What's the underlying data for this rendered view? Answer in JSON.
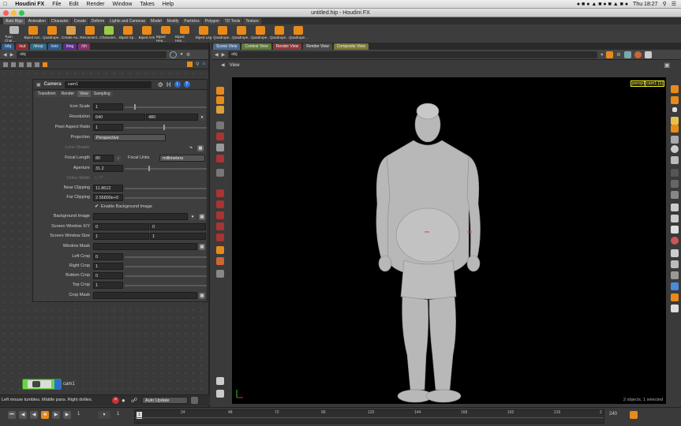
{
  "menubar": {
    "apple": "",
    "app_name": "Houdini FX",
    "items": [
      "File",
      "Edit",
      "Render",
      "Window",
      "Takes",
      "Help"
    ],
    "clock": "Thu 18:27"
  },
  "window": {
    "title": "untitled.hip - Houdini FX"
  },
  "shelf_tabs": [
    "Auto Rigs",
    "Animation",
    "Character",
    "Create",
    "Deform",
    "Lights and Cameras",
    "Model",
    "Modify",
    "Particles",
    "Polygon",
    "TD Tools",
    "Texture"
  ],
  "shelf_tools": [
    "Toon Char...",
    "Biped Aut...",
    "Quadrupe...",
    "Create Au...",
    "Reconnect...",
    "Character...",
    "Biped Sp...",
    "Biped Arm",
    "Biped Hea...",
    "Biped Han...",
    "Biped Leg",
    "Quadrupe...",
    "Quadrupe...",
    "Quadrupe...",
    "Quadrupe...",
    "Quadrupe..."
  ],
  "left": {
    "tabs": [
      "/obj",
      "/out",
      "/shop",
      "/vex",
      "/img",
      "/ch"
    ],
    "path": "obj",
    "node_name": "cam1"
  },
  "params": {
    "type_label": "Camera",
    "name": "cam1",
    "tabs": [
      "Transform",
      "Render",
      "View",
      "Sampling"
    ],
    "icon_scale": {
      "label": "Icon Scale",
      "value": "1"
    },
    "resolution": {
      "label": "Resolution",
      "x": "640",
      "y": "480"
    },
    "pixel_aspect": {
      "label": "Pixel Aspect Ratio",
      "value": "1"
    },
    "projection": {
      "label": "Projection",
      "value": "Perspective"
    },
    "lens_shader": {
      "label": "Lens Shader"
    },
    "focal_length": {
      "label": "Focal Length",
      "value": "80",
      "units_label": "Focal Units",
      "units": "millimeters"
    },
    "aperture": {
      "label": "Aperture",
      "value": "31.2"
    },
    "ortho_width": {
      "label": "Ortho Width",
      "value": "1.77..."
    },
    "near_clipping": {
      "label": "Near Clipping",
      "value": "11.8612"
    },
    "far_clipping": {
      "label": "Far Clipping",
      "value": "2.56800e+0"
    },
    "enable_bg": {
      "label": "Enable Background Image"
    },
    "bg_image": {
      "label": "Background Image"
    },
    "screen_window_xy": {
      "label": "Screen Window X/Y",
      "x": "0",
      "y": "0"
    },
    "screen_window_size": {
      "label": "Screen Window Size",
      "x": "1",
      "y": "1"
    },
    "window_mask": {
      "label": "Window Mask"
    },
    "left_crop": {
      "label": "Left Crop",
      "value": "0"
    },
    "right_crop": {
      "label": "Right Crop",
      "value": "1"
    },
    "bottom_crop": {
      "label": "Bottom Crop",
      "value": "0"
    },
    "top_crop": {
      "label": "Top Crop",
      "value": "1"
    },
    "crop_mask": {
      "label": "Crop Mask"
    }
  },
  "status": {
    "text": "Left mouse tumbles. Middle pans. Right dollies.",
    "auto_update": "Auto Update"
  },
  "right": {
    "tabs": [
      "Scene View",
      "Context View",
      "Render View",
      "Render View",
      "Composite View"
    ],
    "path": "obj",
    "view_label": "View",
    "persp": "persp1",
    "cam": "cam1 [1]",
    "selection": "2 objects, 1 selected"
  },
  "timeline": {
    "frame": "1",
    "start": "1",
    "ticks": [
      "24",
      "48",
      "72",
      "96",
      "120",
      "144",
      "168",
      "192",
      "216",
      "2"
    ],
    "end": "240",
    "range_start": "1"
  },
  "colors": {
    "accent_orange": "#e88a1a",
    "node_green": "#6fd14a",
    "node_blue": "#2a6fd8"
  }
}
